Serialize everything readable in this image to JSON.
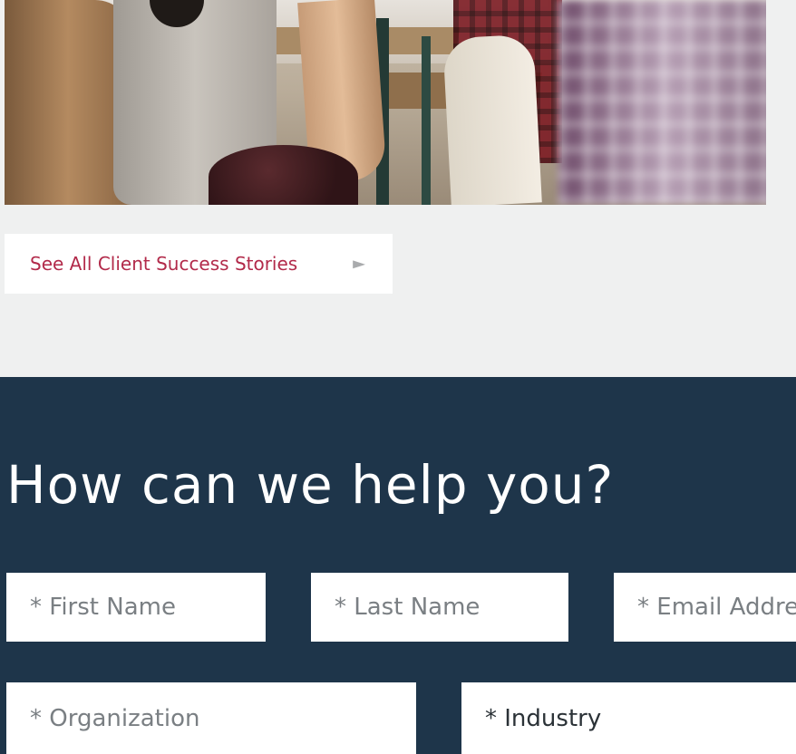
{
  "cta": {
    "label": "See All Client Success Stories",
    "arrow": "►"
  },
  "contact": {
    "title": "How can we help you?",
    "fields": {
      "first_name_placeholder": "* First Name",
      "last_name_placeholder": "* Last Name",
      "email_placeholder": "* Email Address",
      "organization_placeholder": "* Organization",
      "industry_selected": "* Industry"
    }
  },
  "colors": {
    "page_background": "#eff0f0",
    "section_background": "#1e354a",
    "accent": "#b22a4a",
    "field_background": "#ffffff"
  }
}
